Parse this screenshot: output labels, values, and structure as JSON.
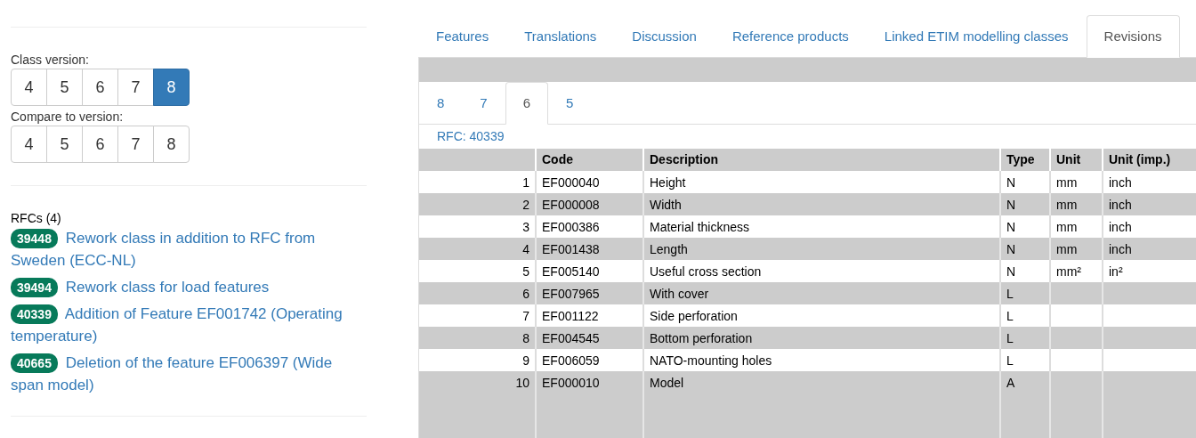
{
  "class_version": {
    "label": "Class version:",
    "options": [
      {
        "label": "4",
        "selected": false
      },
      {
        "label": "5",
        "selected": false
      },
      {
        "label": "6",
        "selected": false
      },
      {
        "label": "7",
        "selected": false
      },
      {
        "label": "8",
        "selected": true
      }
    ]
  },
  "compare_version": {
    "label": "Compare to version:",
    "options": [
      {
        "label": "4",
        "selected": false
      },
      {
        "label": "5",
        "selected": false
      },
      {
        "label": "6",
        "selected": false
      },
      {
        "label": "7",
        "selected": false
      },
      {
        "label": "8",
        "selected": false
      }
    ]
  },
  "rfcs": {
    "heading": "RFCs (4)",
    "items": [
      {
        "number": "39448",
        "title": "Rework class in addition to RFC from Sweden (ECC-NL)"
      },
      {
        "number": "39494",
        "title": "Rework class for load features"
      },
      {
        "number": "40339",
        "title": "Addition of Feature EF001742 (Operating temperature)"
      },
      {
        "number": "40665",
        "title": "Deletion of the feature EF006397 (Wide span model)"
      }
    ]
  },
  "tabs": [
    {
      "label": "Features",
      "selected": false
    },
    {
      "label": "Translations",
      "selected": false
    },
    {
      "label": "Discussion",
      "selected": false
    },
    {
      "label": "Reference products",
      "selected": false
    },
    {
      "label": "Linked ETIM modelling classes",
      "selected": false
    },
    {
      "label": "Revisions",
      "selected": true
    }
  ],
  "revision_tabs": [
    {
      "label": "8",
      "selected": false
    },
    {
      "label": "7",
      "selected": false
    },
    {
      "label": "6",
      "selected": true
    },
    {
      "label": "5",
      "selected": false
    }
  ],
  "rfc_link": "RFC: 40339",
  "table": {
    "columns": [
      "",
      "Code",
      "Description",
      "Type",
      "Unit",
      "Unit (imp.)"
    ],
    "rows": [
      [
        "1",
        "EF000040",
        "Height",
        "N",
        "mm",
        "inch"
      ],
      [
        "2",
        "EF000008",
        "Width",
        "N",
        "mm",
        "inch"
      ],
      [
        "3",
        "EF000386",
        "Material thickness",
        "N",
        "mm",
        "inch"
      ],
      [
        "4",
        "EF001438",
        "Length",
        "N",
        "mm",
        "inch"
      ],
      [
        "5",
        "EF005140",
        "Useful cross section",
        "N",
        "mm²",
        "in²"
      ],
      [
        "6",
        "EF007965",
        "With cover",
        "L",
        "",
        ""
      ],
      [
        "7",
        "EF001122",
        "Side perforation",
        "L",
        "",
        ""
      ],
      [
        "8",
        "EF004545",
        "Bottom perforation",
        "L",
        "",
        ""
      ],
      [
        "9",
        "EF006059",
        "NATO-mounting holes",
        "L",
        "",
        ""
      ],
      [
        "10",
        "EF000010",
        "Model",
        "A",
        "",
        ""
      ]
    ]
  }
}
